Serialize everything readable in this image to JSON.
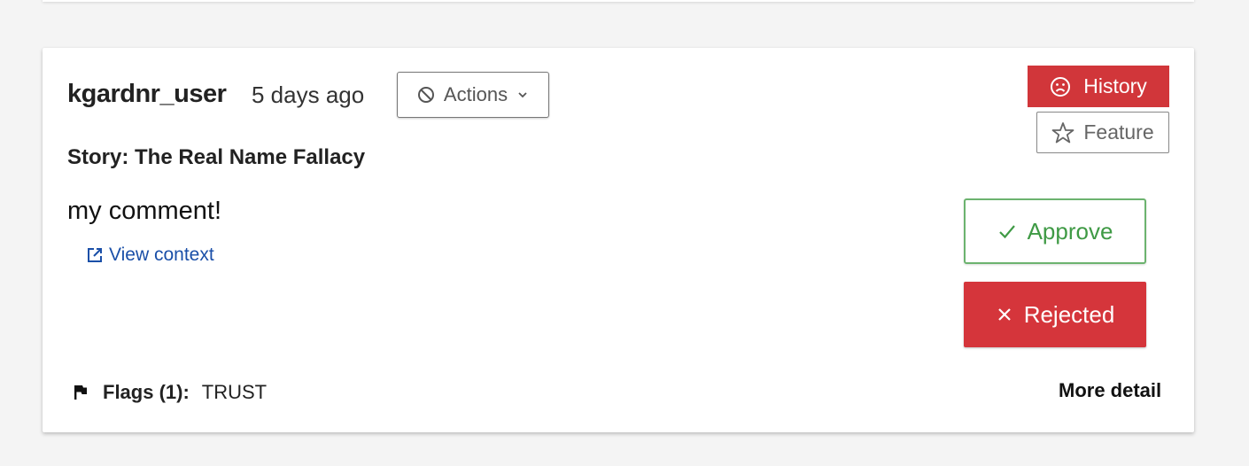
{
  "comment": {
    "username": "kgardnr_user",
    "timestamp": "5 days ago",
    "actions_label": "Actions",
    "story_title": "Story: The Real Name Fallacy",
    "body": "my comment!",
    "view_context_label": "View context",
    "flags_label": "Flags (1):",
    "flags_value": "TRUST",
    "more_detail_label": "More detail"
  },
  "buttons": {
    "history_label": "History",
    "feature_label": "Feature",
    "approve_label": "Approve",
    "rejected_label": "Rejected"
  },
  "icons": {
    "actions": "block-icon",
    "actions_chevron": "chevron-down-icon",
    "external_link": "external-link-icon",
    "history": "sad-face-icon",
    "feature": "star-outline-icon",
    "approve": "check-icon",
    "rejected": "close-icon",
    "flag": "flag-icon"
  },
  "colors": {
    "reject_red": "#d5353b",
    "approve_green": "#3f9a45",
    "link_blue": "#1a4fa8"
  }
}
